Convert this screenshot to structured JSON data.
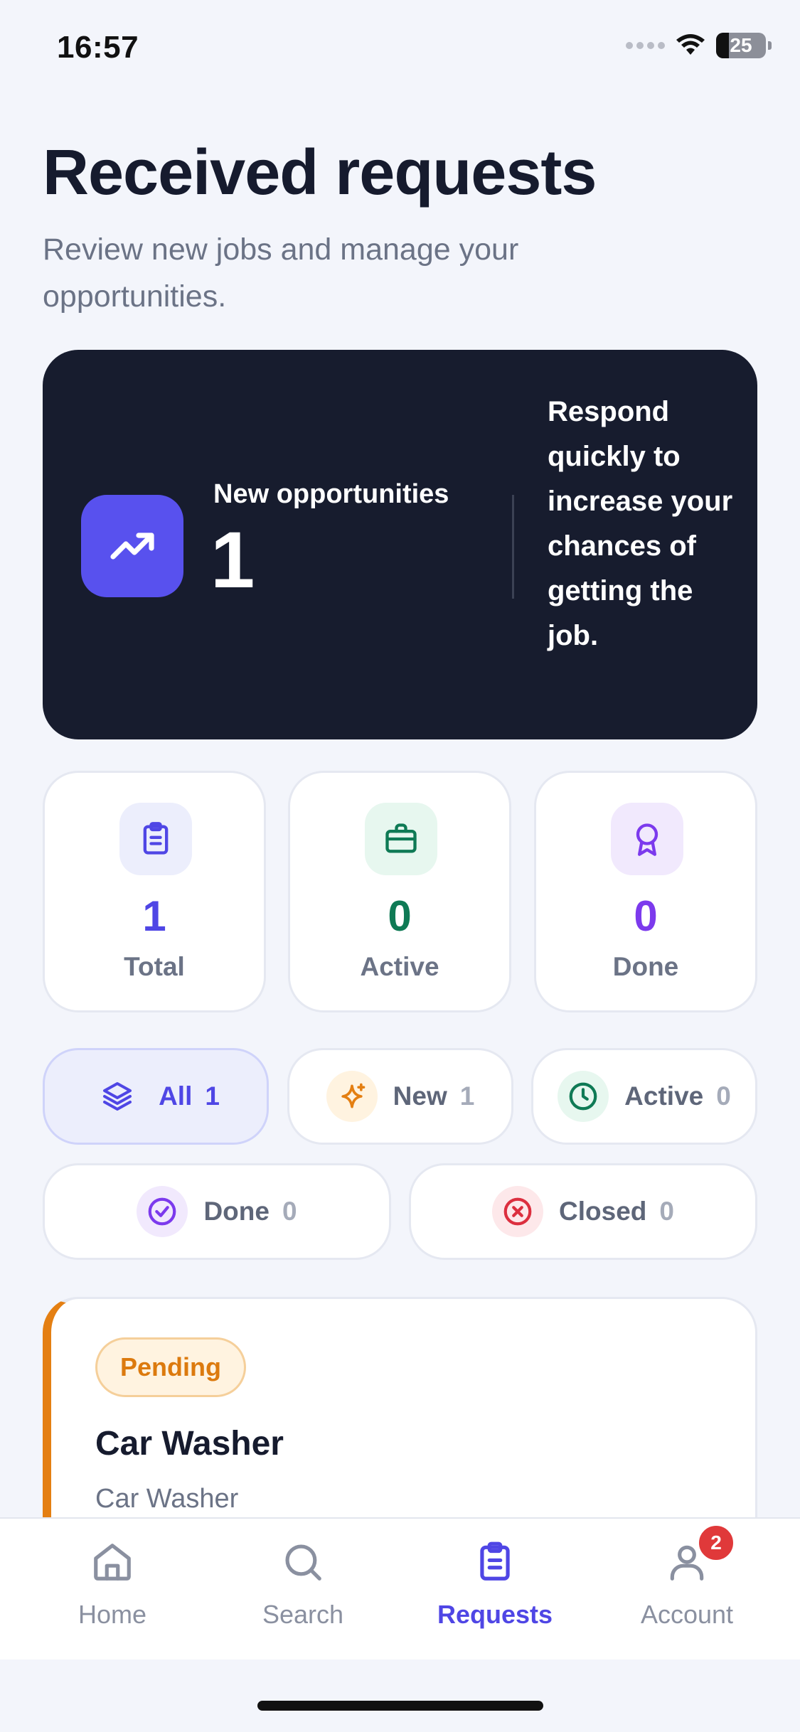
{
  "status_bar": {
    "time": "16:57",
    "battery": "25"
  },
  "header": {
    "title": "Received requests",
    "subtitle": "Review new jobs and manage your opportunities."
  },
  "hero": {
    "label": "New opportunities",
    "count": "1",
    "tip": "Respond quickly to increase your chances of getting the job.",
    "icon": "trending-up-icon"
  },
  "stats": [
    {
      "value": "1",
      "label": "Total",
      "icon": "clipboard-list-icon",
      "color": "#4f46e5",
      "bg": "#eceefc"
    },
    {
      "value": "0",
      "label": "Active",
      "icon": "briefcase-icon",
      "color": "#0f7a55",
      "bg": "#e7f7ef"
    },
    {
      "value": "0",
      "label": "Done",
      "icon": "award-icon",
      "color": "#7c3aed",
      "bg": "#f1e9fd"
    }
  ],
  "filters": [
    {
      "label": "All",
      "count": "1",
      "icon": "layers-icon",
      "selected": true
    },
    {
      "label": "New",
      "count": "1",
      "icon": "sparkles-icon",
      "color": "#e47f12",
      "bg": "#fff3e0"
    },
    {
      "label": "Active",
      "count": "0",
      "icon": "clock-icon",
      "color": "#0f7a55",
      "bg": "#e7f7ef"
    },
    {
      "label": "Done",
      "count": "0",
      "icon": "check-circle-icon",
      "color": "#7c3aed",
      "bg": "#f1e9fd"
    },
    {
      "label": "Closed",
      "count": "0",
      "icon": "x-circle-icon",
      "color": "#dc2f3f",
      "bg": "#fde8ea"
    }
  ],
  "request": {
    "status": "Pending",
    "title": "Car Washer",
    "subtitle": "Car Washer",
    "accent": "#e47f12"
  },
  "nav": {
    "items": [
      {
        "label": "Home",
        "icon": "home-icon"
      },
      {
        "label": "Search",
        "icon": "search-icon"
      },
      {
        "label": "Requests",
        "icon": "clipboard-list-icon",
        "active": true
      },
      {
        "label": "Account",
        "icon": "user-icon",
        "badge": "2"
      }
    ]
  },
  "colors": {
    "accent": "#4f46e5",
    "dark_card": "#171c2e",
    "background": "#f3f5fb"
  }
}
